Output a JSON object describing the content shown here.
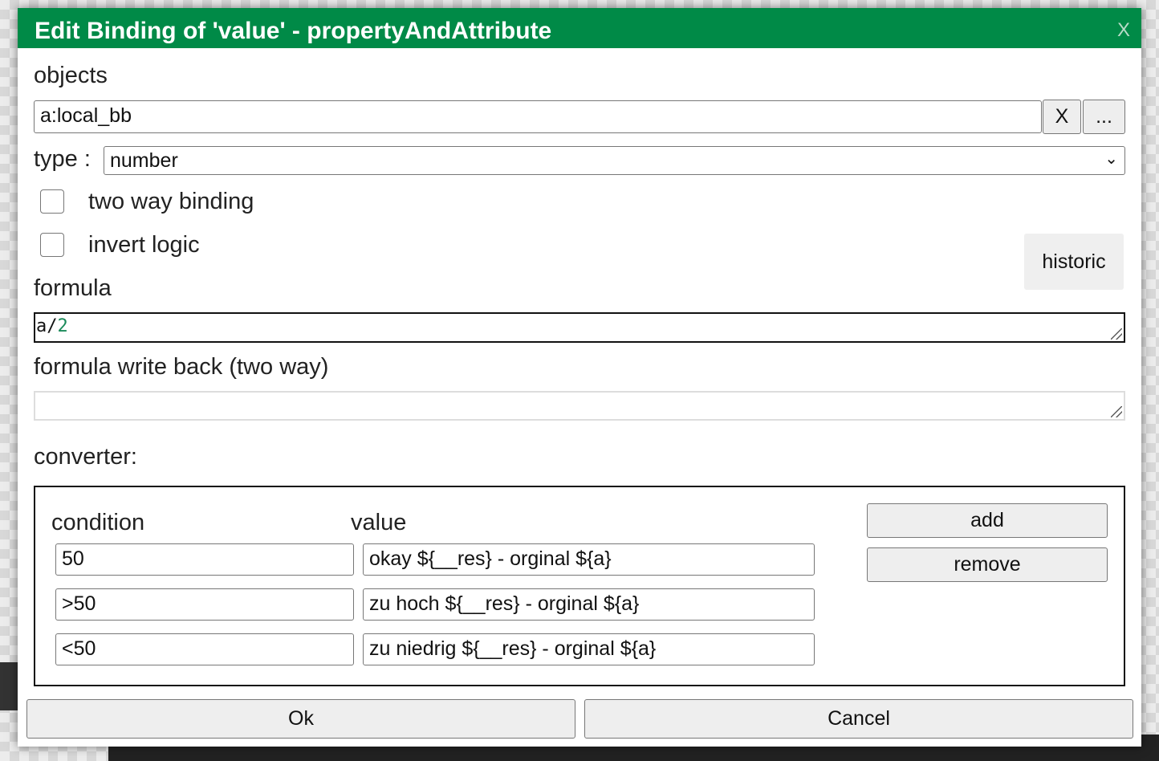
{
  "dialog": {
    "title": "Edit Binding of 'value' - propertyAndAttribute",
    "close_label": "X"
  },
  "objects": {
    "label": "objects",
    "value": "a:local_bb",
    "clear_label": "X",
    "browse_label": "..."
  },
  "type": {
    "label": "type :",
    "value": "number"
  },
  "two_way": {
    "label": "two way binding",
    "checked": false
  },
  "invert": {
    "label": "invert logic",
    "checked": false
  },
  "historic_label": "historic",
  "formula": {
    "label": "formula",
    "value_var": "a/",
    "value_num": "2",
    "number_color": "#1a8a5a"
  },
  "write_back": {
    "label": "formula write back (two way)",
    "value": ""
  },
  "converter": {
    "label": "converter:",
    "condition_header": "condition",
    "value_header": "value",
    "add_label": "add",
    "remove_label": "remove",
    "rows": [
      {
        "condition": "50",
        "value": "okay ${__res} - orginal ${a}"
      },
      {
        "condition": ">50",
        "value": "zu hoch ${__res} - orginal ${a}"
      },
      {
        "condition": "<50",
        "value": "zu niedrig ${__res} - orginal ${a}"
      }
    ]
  },
  "footer": {
    "ok_label": "Ok",
    "cancel_label": "Cancel"
  },
  "colors": {
    "title_bar": "#008a47"
  }
}
